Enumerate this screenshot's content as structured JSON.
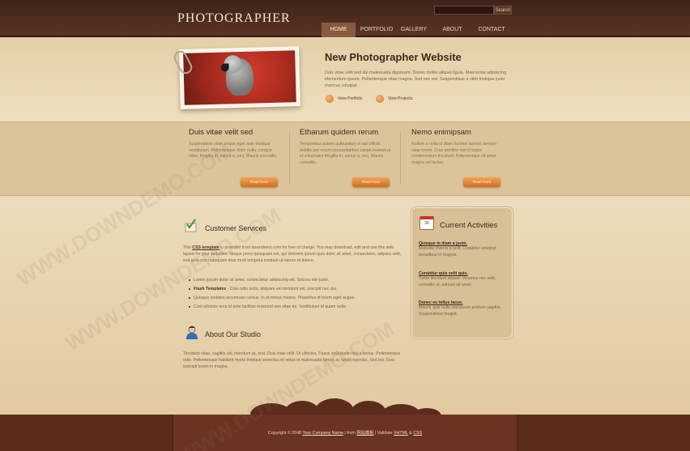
{
  "header": {
    "logo": "PHOTOGRAPHER",
    "search_button": "Search",
    "nav": [
      {
        "label": "HOME",
        "active": true
      },
      {
        "label": "PORTFOLIO",
        "active": false
      },
      {
        "label": "GALLERY",
        "active": false
      },
      {
        "label": "ABOUT",
        "active": false
      },
      {
        "label": "CONTACT",
        "active": false
      }
    ]
  },
  "hero": {
    "title": "New Photographer Website",
    "text": "Duis vitae velit sed dui malesuada dignissim. Donec mollis aliquet ligula. Maecenas adipiscing elementum ipsum. Pellentesque vitae magna. Sed nec est. Suspendisse a nibh tristique justo rhoncus volutpat.",
    "link1": "View Portfolio",
    "link2": "View Projects"
  },
  "features": [
    {
      "title": "Duis vitae velit sed",
      "text": "Suspendisse vitae neque eget ante tristique vestibulum. Pellentesque dolor nulla, congue vitae, fringilla in, varius a, orci. Mauris convallis.",
      "button": "Read more"
    },
    {
      "title": "Etharum quidem rerum",
      "text": "Temporibus autem quibusdam et aut officiis debitis aut rerum necessitatibus saepe eveniet ut et voluptates fringilla in, varius a, orci. Mauris convallis.",
      "button": "Read more"
    },
    {
      "title": "Nemo enimipsam",
      "text": "Nullam a nulla id diam facilisis laoreet semper vitae lorem. Cras porttitor nisi id turpis condimentum tincidunt. Pellentesque sit amet magna vel lectus.",
      "button": "Read more"
    }
  ],
  "customer_services": {
    "title": "Customer Services",
    "intro_pre": "This ",
    "intro_link": "CSS template",
    "intro_post": " is provided from downdemo.com for free of charge. You may download, edit and use this web layout for your websites. Neque porro quisquam est, qui dolorem ipsum quia dolor sit amet, consectetur, adipisci velit, sed quia non numquam eius modi tempora incidunt ut labore et dolore.",
    "bullets": [
      {
        "bold": "",
        "text": "Lorem ipsum dolor sit amet, consectetur adipiscing elit. Sed eu nisi justo."
      },
      {
        "bold": "Flash Templates",
        "text": " - Cras odio nulla, aliquam vel tincidunt vel, suscipit nec dui."
      },
      {
        "bold": "",
        "text": "Quisque sodales accumsan cursus. In at metus massa. Phasellus id lorem eget augue."
      },
      {
        "bold": "",
        "text": "Cum ultricies arcu id ante facilisis euismod non vitae mi. Vestibulum id quam nulla."
      }
    ]
  },
  "about": {
    "title": "About Our Studio",
    "text": "Tincidunt vitae, sagittis vel, interdum at, erat. Duis vitae velit. Ut ultricies. Fusce sollicitudin nisl a lectus. Pellentesque odio. Pellentesque habitant morbi tristique senectus et netus et malesuada fames ac turpis egestas. Sed leo. Duis suscipit lorem in magna."
  },
  "activities": {
    "title": "Current Activities",
    "calendar_day": "30",
    "items": [
      {
        "link": "Quisque in diam a justo.",
        "text": "Molestie viverra a velit. Curabitur volutpat penatibus et magnis."
      },
      {
        "link": "Curabitur quis velit quis.",
        "text": "Tortor tincidunt aliquet. Vivamus nec velit, convallis ut, ultrices sit amet."
      },
      {
        "link": "Donec eu tellus lacus.",
        "text": "Mauris quis nulla sed ipsum pretium sagittis. Suspendisse feugiat."
      }
    ]
  },
  "footer": {
    "copyright": "Copyright © 2048 ",
    "company": "Your Company Name",
    "from_label": " | from ",
    "from_link": "网站模板",
    "validate_label": " | Validate ",
    "xhtml": "XHTML",
    "amp": " & ",
    "css": "CSS"
  },
  "watermark": "WWW.DOWNDEMO.COM"
}
